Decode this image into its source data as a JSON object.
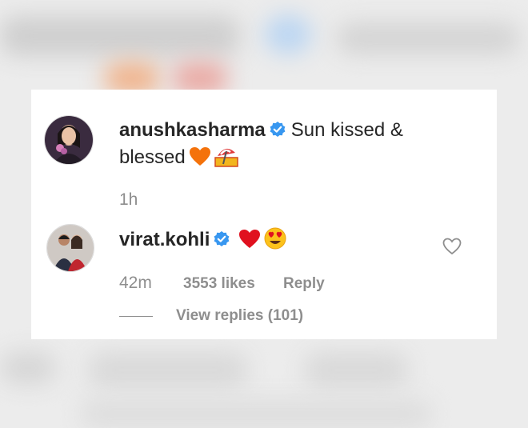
{
  "post_comment": {
    "username": "anushkasharma",
    "text_line1": "Sun kissed &",
    "text_line2": "blessed",
    "time": "1h"
  },
  "reply_comment": {
    "username": "virat.kohli",
    "time": "42m",
    "likes": "3553 likes",
    "reply_label": "Reply",
    "view_replies": "View replies (101)"
  },
  "colors": {
    "verified_blue": "#3897f0",
    "text": "#262626",
    "muted": "#8e8e8e"
  }
}
